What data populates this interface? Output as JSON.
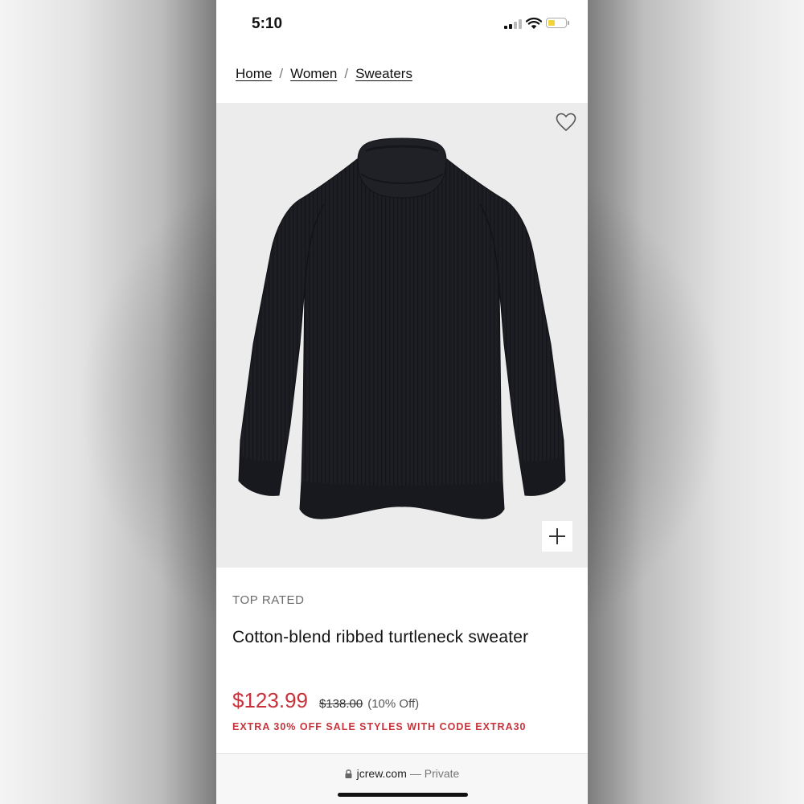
{
  "status_bar": {
    "time": "5:10"
  },
  "breadcrumb": {
    "items": [
      {
        "label": "Home"
      },
      {
        "label": "Women"
      },
      {
        "label": "Sweaters"
      }
    ],
    "separator": "/"
  },
  "product": {
    "image_alt": "Black ribbed turtleneck sweater",
    "badge": "TOP RATED",
    "title": "Cotton-blend ribbed turtleneck sweater",
    "sale_price": "$123.99",
    "original_price": "$138.00",
    "discount": "(10% Off)",
    "promo": "EXTRA 30% OFF SALE STYLES WITH CODE EXTRA30"
  },
  "browser": {
    "domain": "jcrew.com",
    "privacy": "— Private"
  },
  "icons": {
    "heart": "heart-outline-icon",
    "zoom": "plus-icon",
    "lock": "lock-icon"
  },
  "colors": {
    "sale_red": "#c8323a",
    "image_bg": "#ececec",
    "sweater": "#1c1d22"
  }
}
